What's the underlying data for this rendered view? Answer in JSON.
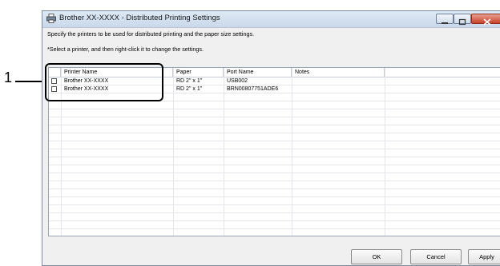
{
  "window": {
    "title": "Brother XX-XXXX - Distributed Printing Settings",
    "instruction_line1": "Specify the printers to be used for distributed printing and the paper size settings.",
    "instruction_line2": "*Select a printer, and then right-click it to change the settings."
  },
  "callout": {
    "number": "1"
  },
  "table": {
    "columns": [
      "Printer Name",
      "Paper",
      "Port Name",
      "Notes"
    ],
    "rows": [
      {
        "printer": "Brother XX-XXXX",
        "paper": "RD 2\" x 1\"",
        "port": "USB002",
        "notes": ""
      },
      {
        "printer": "Brother XX-XXXX",
        "paper": "RD 2\" x 1\"",
        "port": "BRN00807751ADE6",
        "notes": ""
      }
    ]
  },
  "buttons": {
    "ok": "OK",
    "cancel": "Cancel",
    "apply": "Apply"
  },
  "colors": {
    "titlebar": "#c9d8ea",
    "close_button": "#c7402a",
    "highlight_border": "#000000"
  }
}
